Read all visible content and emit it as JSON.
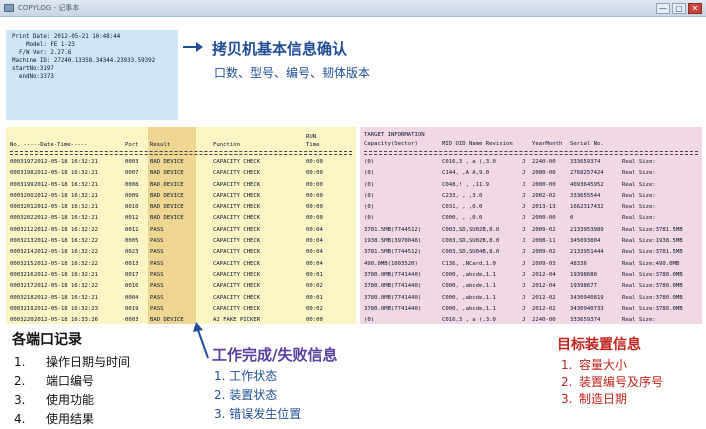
{
  "window": {
    "title": "COPYLOG - 记事本",
    "close": "✕",
    "max": "▢",
    "min": "—"
  },
  "print_info": {
    "lines": [
      "Print Date: 2012-05-21 10:48:44",
      "",
      "    Model: FE 1-23",
      "  F/W Ver: 2.27.6",
      "Machine ID: 27240.13358.34344.23933.59392",
      "",
      "startNo:3197",
      "  endNo:3373"
    ]
  },
  "top_note": {
    "title": "拷贝机基本信息确认",
    "subtitle": "口数、型号、编号、韧体版本"
  },
  "log": {
    "headers": {
      "no_date": "No.  -----Date-Time-----",
      "port": "Port",
      "result": "Result",
      "function": "Function",
      "run": "RUN",
      "time": "Time"
    },
    "rows": [
      [
        "0003197",
        "2012-05-18 16:32:21",
        "0003",
        "BAD DEVICE",
        "CAPACITY CHECK",
        "00:00"
      ],
      [
        "0003198",
        "2012-05-18 16:32:21",
        "0007",
        "BAD DEVICE",
        "CAPACITY CHECK",
        "00:00"
      ],
      [
        "0003199",
        "2012-05-18 16:32:21",
        "0008",
        "BAD DEVICE",
        "CAPACITY CHECK",
        "00:00"
      ],
      [
        "0003200",
        "2012-05-18 16:32:21",
        "0009",
        "BAD DEVICE",
        "CAPACITY CHECK",
        "00:00"
      ],
      [
        "0003201",
        "2012-05-18 16:32:21",
        "0010",
        "BAD DEVICE",
        "CAPACITY CHECK",
        "00:00"
      ],
      [
        "0003202",
        "2012-05-18 16:32:21",
        "0012",
        "BAD DEVICE",
        "CAPACITY CHECK",
        "00:00"
      ],
      [
        "0003212",
        "2012-05-18 16:32:22",
        "0011",
        "PASS",
        "CAPACITY CHECK",
        "00:04"
      ],
      [
        "0003213",
        "2012-05-18 16:32:22",
        "0005",
        "PASS",
        "CAPACITY CHECK",
        "00:04"
      ],
      [
        "0003214",
        "2012-05-18 16:32:22",
        "0023",
        "PASS",
        "CAPACITY CHECK",
        "00:04"
      ],
      [
        "0003215",
        "2012-05-18 16:32:22",
        "0013",
        "PASS",
        "CAPACITY CHECK",
        "00:04"
      ],
      [
        "0003216",
        "2012-05-18 16:32:21",
        "0017",
        "PASS",
        "CAPACITY CHECK",
        "00:01"
      ],
      [
        "0003217",
        "2012-05-18 16:32:22",
        "0016",
        "PASS",
        "CAPACITY CHECK",
        "00:02"
      ],
      [
        "0003218",
        "2012-05-18 16:32:21",
        "0004",
        "PASS",
        "CAPACITY CHECK",
        "00:01"
      ],
      [
        "0003219",
        "2012-05-18 16:32:23",
        "0019",
        "PASS",
        "CAPACITY CHECK",
        "00:02"
      ],
      [
        "0003220",
        "2012-05-18 16:33:26",
        "0003",
        "BAD DEVICE",
        "A2 FAKE PICKER",
        "00:00"
      ]
    ]
  },
  "target": {
    "headers": {
      "info": "TARGET INFORMATION",
      "capacity": "Capacity(Sector)",
      "ids": "MID OID Name Revision",
      "ym": "YearMonth",
      "serial": "Serial No."
    },
    "rows": [
      [
        "(0)",
        "C016,3 , a (,3.0",
        "J",
        "2240-00",
        "333659374",
        "Real Size:"
      ],
      [
        "(0)",
        "C144, ,A  A,9.0",
        "J",
        "2080-00",
        "2768257424",
        "Real Size:"
      ],
      [
        "(0)",
        "C048,! , ,11.9",
        "J",
        "2000-00",
        "4093645952",
        "Real Size:"
      ],
      [
        "(0)",
        "C233, , ,3.0",
        "J",
        "2002-02",
        "333655544",
        "Real Size:"
      ],
      [
        "(0)",
        "C031, , ,0.0",
        "J",
        "2013-13",
        "1662317432",
        "Real Size:"
      ],
      [
        "(0)",
        "C000, , ,0.0",
        "J",
        "2000-00",
        "0",
        "Real Size:"
      ],
      [
        "3781.5MB(7744512)",
        "C003,SD,SU02B,8.0",
        "J",
        "2009-02",
        "2133953989",
        "Real Size:3781.5MB"
      ],
      [
        "1938.5MB(3970048)",
        "C003,SD,SU02B,8.0",
        "J",
        "2008-11",
        "345093804",
        "Real Size:1938.5MB"
      ],
      [
        "3781.5MB(7744512)",
        "C003,SD,SU04B,8.0",
        "J",
        "2009-02",
        "2133951444",
        "Real Size:3781.5MB"
      ],
      [
        "490.0MB(1003520)",
        "C136, ,NCard,1.0",
        "J",
        "2009-03",
        "48336",
        "Real Size:490.0MB"
      ],
      [
        "3780.0MB(7741440)",
        "C000, ,abcde,1.1",
        "J",
        "2012-04",
        "19398680",
        "Real Size:3780.0MB"
      ],
      [
        "3780.0MB(7741440)",
        "C000, ,abcde,1.1",
        "J",
        "2012-04",
        "19398677",
        "Real Size:3780.0MB"
      ],
      [
        "3780.0MB(7741440)",
        "C000, ,abcde,1.1",
        "J",
        "2012-02",
        "3430940819",
        "Real Size:3780.0MB"
      ],
      [
        "3780.0MB(7741440)",
        "C000, ,abcde,1.1",
        "J",
        "2012-02",
        "3430940733",
        "Real Size:3780.0MB"
      ],
      [
        "(0)",
        "C016,3 , a (,3.0",
        "J",
        "2240-00",
        "333659374",
        "Real Size:"
      ]
    ]
  },
  "legend_left": {
    "title": "各端口记录",
    "items": [
      {
        "n": "1.",
        "t": "操作日期与时间"
      },
      {
        "n": "2.",
        "t": "端口编号"
      },
      {
        "n": "3.",
        "t": "使用功能"
      },
      {
        "n": "4.",
        "t": "使用结果"
      }
    ]
  },
  "legend_mid": {
    "title": "工作完成/失败信息",
    "items": [
      "1. 工作状态",
      "2. 装置状态",
      "3. 错误发生位置"
    ]
  },
  "legend_right": {
    "title": "目标装置信息",
    "items": [
      {
        "n": "1.",
        "t": "容量大小"
      },
      {
        "n": "2.",
        "t": "装置编号及序号"
      },
      {
        "n": "3.",
        "t": "制造日期"
      }
    ]
  },
  "colors": {
    "print_bg": "#cde5f7",
    "log_bg": "#fbf4c3",
    "result_col": "#eed592",
    "target_bg": "#f2d7e4",
    "blue_text": "#1f4e97",
    "red_text": "#c0241c",
    "purple_title": "#5a3fa0"
  }
}
